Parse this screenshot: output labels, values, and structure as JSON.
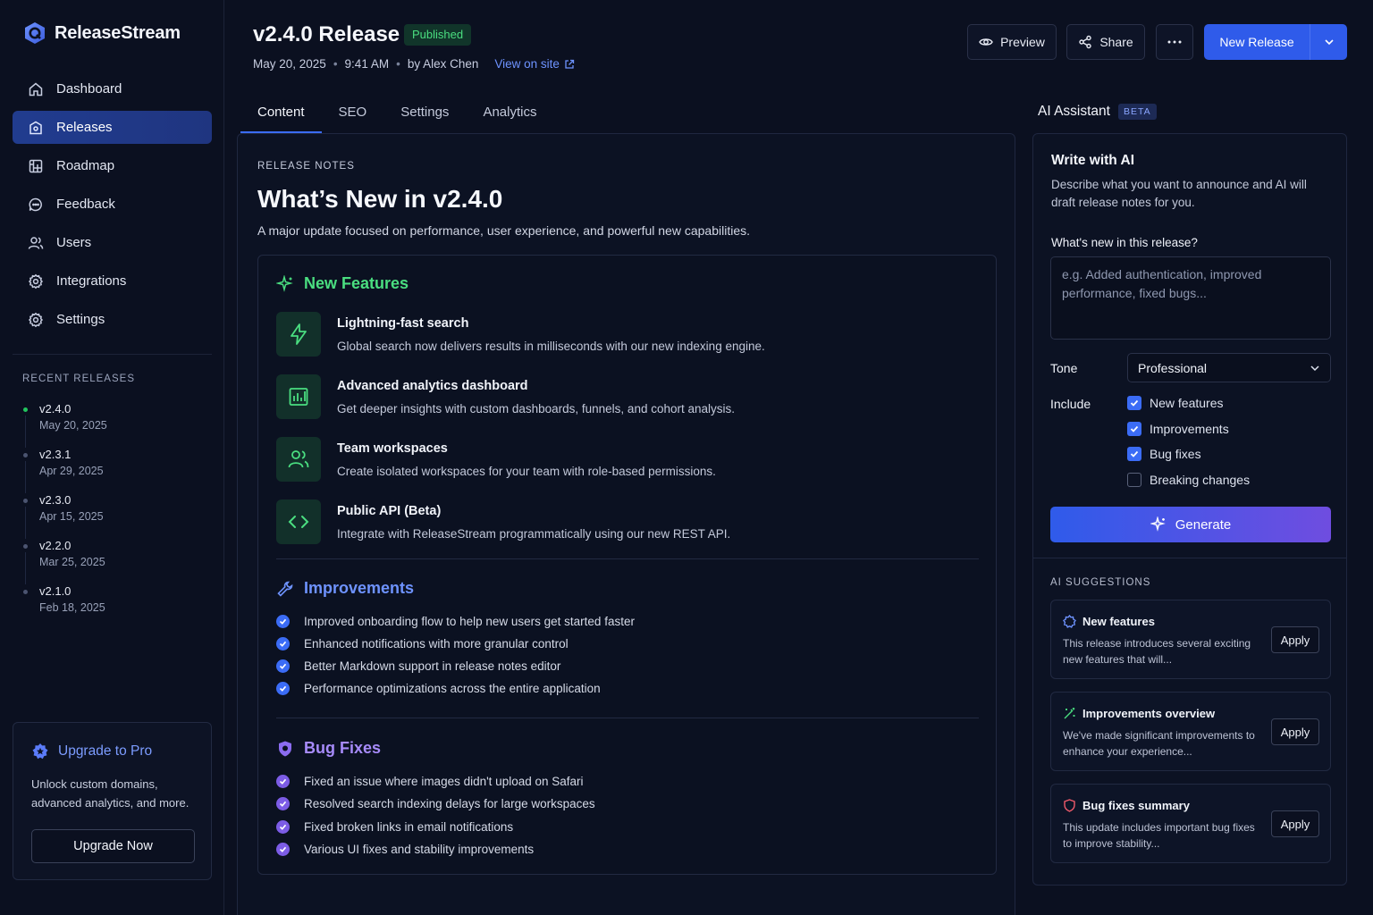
{
  "app": {
    "name": "ReleaseStream"
  },
  "colors": {
    "accent": "#2f5bea",
    "published": "#4ade80",
    "features": "#4ade80",
    "improvements": "#6e93ff",
    "bugfixes": "#a78bfa"
  },
  "sidebar": {
    "items": [
      {
        "label": "Dashboard",
        "icon": "home-icon"
      },
      {
        "label": "Releases",
        "icon": "package-icon",
        "active": true
      },
      {
        "label": "Roadmap",
        "icon": "roadmap-icon"
      },
      {
        "label": "Feedback",
        "icon": "chat-icon"
      },
      {
        "label": "Users",
        "icon": "users-icon"
      },
      {
        "label": "Integrations",
        "icon": "puzzle-icon"
      },
      {
        "label": "Settings",
        "icon": "gear-icon"
      }
    ],
    "recent_title": "RECENT RELEASES",
    "recent": [
      {
        "version": "v2.4.0",
        "date": "May 20, 2025"
      },
      {
        "version": "v2.3.1",
        "date": "Apr 29, 2025"
      },
      {
        "version": "v2.3.0",
        "date": "Apr 15, 2025"
      },
      {
        "version": "v2.2.0",
        "date": "Mar 25, 2025"
      },
      {
        "version": "v2.1.0",
        "date": "Feb 18, 2025"
      }
    ],
    "upgrade": {
      "title": "Upgrade to Pro",
      "description": "Unlock custom domains, advanced analytics, and more.",
      "button": "Upgrade Now"
    }
  },
  "header": {
    "title": "v2.4.0 Release",
    "status": "Published",
    "date": "May 20, 2025",
    "time": "9:41 AM",
    "author": "by Alex Chen",
    "view_link": "View on site",
    "preview": "Preview",
    "share": "Share",
    "new_release": "New Release"
  },
  "tabs": [
    {
      "label": "Content",
      "active": true
    },
    {
      "label": "SEO"
    },
    {
      "label": "Settings"
    },
    {
      "label": "Analytics"
    }
  ],
  "content": {
    "label": "RELEASE NOTES",
    "title": "What’s New in v2.4.0",
    "subtitle": "A major update focused on performance, user experience, and powerful new capabilities.",
    "features_heading": "New Features",
    "features": [
      {
        "title": "Lightning-fast search",
        "desc": "Global search now delivers results in milliseconds with our new indexing engine.",
        "icon": "bolt-icon"
      },
      {
        "title": "Advanced analytics dashboard",
        "desc": "Get deeper insights with custom dashboards, funnels, and cohort analysis.",
        "icon": "analytics-icon"
      },
      {
        "title": "Team workspaces",
        "desc": "Create isolated workspaces for your team with role-based permissions.",
        "icon": "team-icon"
      },
      {
        "title": "Public API (Beta)",
        "desc": "Integrate with ReleaseStream programmatically using our new REST API.",
        "icon": "code-icon"
      }
    ],
    "improvements_heading": "Improvements",
    "improvements": [
      "Improved onboarding flow to help new users get started faster",
      "Enhanced notifications with more granular control",
      "Better Markdown support in release notes editor",
      "Performance optimizations across the entire application"
    ],
    "bugfixes_heading": "Bug Fixes",
    "bugfixes": [
      "Fixed an issue where images didn't upload on Safari",
      "Resolved search indexing delays for large workspaces",
      "Fixed broken links in email notifications",
      "Various UI fixes and stability improvements"
    ]
  },
  "ai": {
    "heading": "AI Assistant",
    "beta": "BETA",
    "title": "Write with AI",
    "description": "Describe what you want to announce and AI will draft release notes for you.",
    "question": "What's new in this release?",
    "placeholder": "e.g. Added authentication, improved performance, fixed bugs...",
    "tone_label": "Tone",
    "tone_value": "Professional",
    "include_label": "Include",
    "include": [
      {
        "label": "New features",
        "checked": true
      },
      {
        "label": "Improvements",
        "checked": true
      },
      {
        "label": "Bug fixes",
        "checked": true
      },
      {
        "label": "Breaking changes",
        "checked": false
      }
    ],
    "generate": "Generate",
    "suggestions_label": "AI SUGGESTIONS",
    "suggestions": [
      {
        "title": "New features",
        "desc": "This release introduces several exciting new features that will...",
        "apply": "Apply"
      },
      {
        "title": "Improvements overview",
        "desc": "We've made significant improvements to enhance your experience...",
        "apply": "Apply"
      },
      {
        "title": "Bug fixes summary",
        "desc": "This update includes important bug fixes to improve stability...",
        "apply": "Apply"
      }
    ]
  }
}
